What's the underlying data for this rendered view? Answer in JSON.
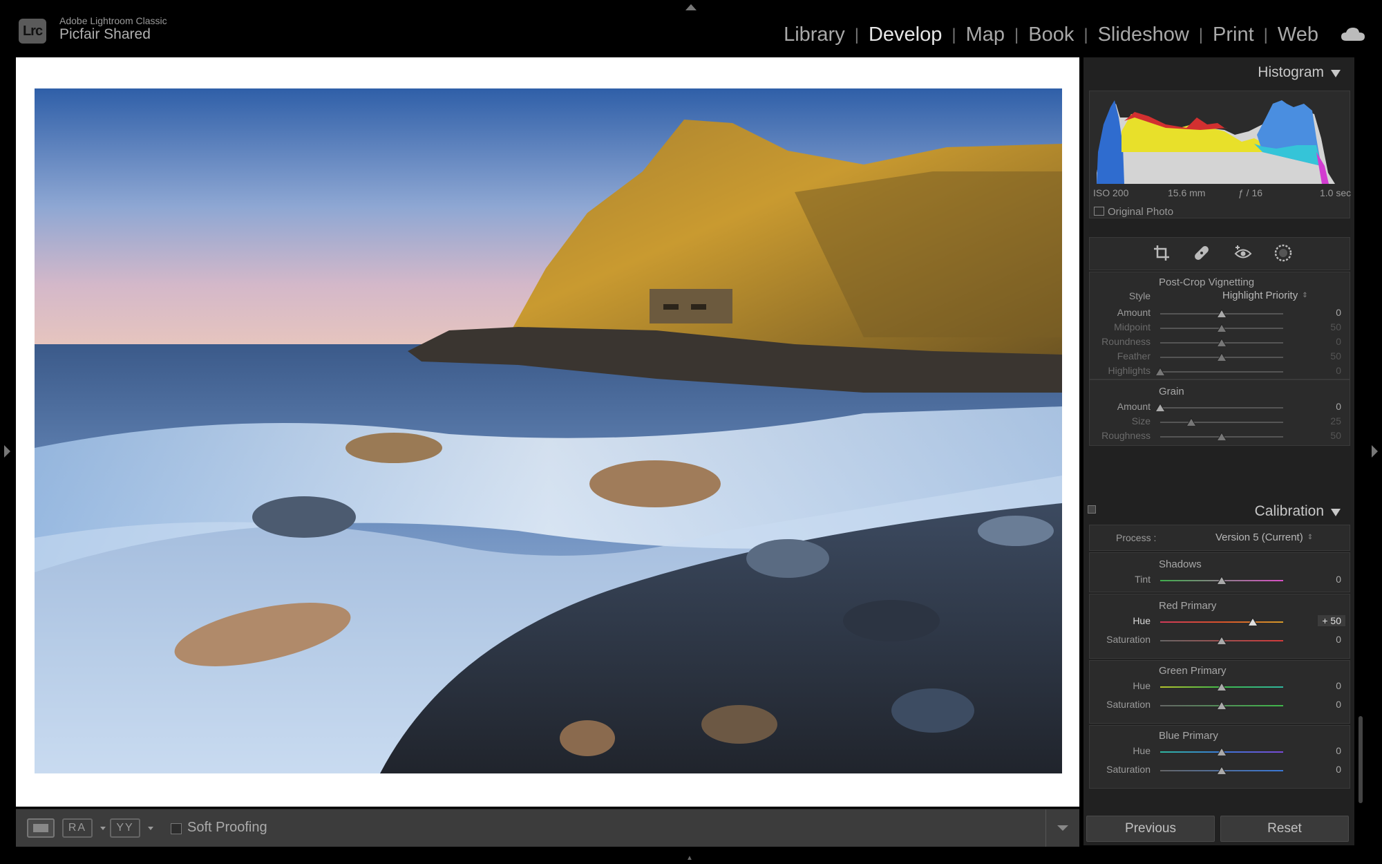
{
  "app": {
    "name": "Adobe Lightroom Classic",
    "catalog": "Picfair Shared",
    "logo_text": "Lrc"
  },
  "modules": [
    {
      "label": "Library",
      "active": false
    },
    {
      "label": "Develop",
      "active": true
    },
    {
      "label": "Map",
      "active": false
    },
    {
      "label": "Book",
      "active": false
    },
    {
      "label": "Slideshow",
      "active": false
    },
    {
      "label": "Print",
      "active": false
    },
    {
      "label": "Web",
      "active": false
    }
  ],
  "toolbar": {
    "ra_label": "RA",
    "yy_label": "YY",
    "soft_proofing": "Soft Proofing"
  },
  "histogram": {
    "title": "Histogram",
    "exif": {
      "iso": "ISO 200",
      "focal": "15.6 mm",
      "aperture": "ƒ / 16",
      "shutter": "1.0 sec"
    },
    "original_photo": "Original Photo"
  },
  "tools": [
    "crop-icon",
    "healing-icon",
    "red-eye-icon",
    "masking-icon"
  ],
  "vignetting": {
    "title": "Post-Crop Vignetting",
    "style_label": "Style",
    "style_value": "Highlight Priority",
    "sliders": [
      {
        "label": "Amount",
        "value": "0",
        "pos": 0.5,
        "dim": false
      },
      {
        "label": "Midpoint",
        "value": "50",
        "pos": 0.5,
        "dim": true
      },
      {
        "label": "Roundness",
        "value": "0",
        "pos": 0.5,
        "dim": true
      },
      {
        "label": "Feather",
        "value": "50",
        "pos": 0.5,
        "dim": true
      },
      {
        "label": "Highlights",
        "value": "0",
        "pos": 0.0,
        "dim": true
      }
    ]
  },
  "grain": {
    "title": "Grain",
    "sliders": [
      {
        "label": "Amount",
        "value": "0",
        "pos": 0.0,
        "dim": false
      },
      {
        "label": "Size",
        "value": "25",
        "pos": 0.25,
        "dim": true
      },
      {
        "label": "Roughness",
        "value": "50",
        "pos": 0.5,
        "dim": true
      }
    ]
  },
  "calibration": {
    "title": "Calibration",
    "process_label": "Process :",
    "process_value": "Version 5 (Current)",
    "shadows": {
      "title": "Shadows",
      "tint": {
        "label": "Tint",
        "value": "0",
        "pos": 0.5
      }
    },
    "red": {
      "title": "Red Primary",
      "hue": {
        "label": "Hue",
        "value": "+ 50",
        "pos": 0.75
      },
      "saturation": {
        "label": "Saturation",
        "value": "0",
        "pos": 0.5
      }
    },
    "green": {
      "title": "Green Primary",
      "hue": {
        "label": "Hue",
        "value": "0",
        "pos": 0.5
      },
      "saturation": {
        "label": "Saturation",
        "value": "0",
        "pos": 0.5
      }
    },
    "blue": {
      "title": "Blue Primary",
      "hue": {
        "label": "Hue",
        "value": "0",
        "pos": 0.5
      },
      "saturation": {
        "label": "Saturation",
        "value": "0",
        "pos": 0.5
      }
    }
  },
  "buttons": {
    "previous": "Previous",
    "reset": "Reset"
  }
}
